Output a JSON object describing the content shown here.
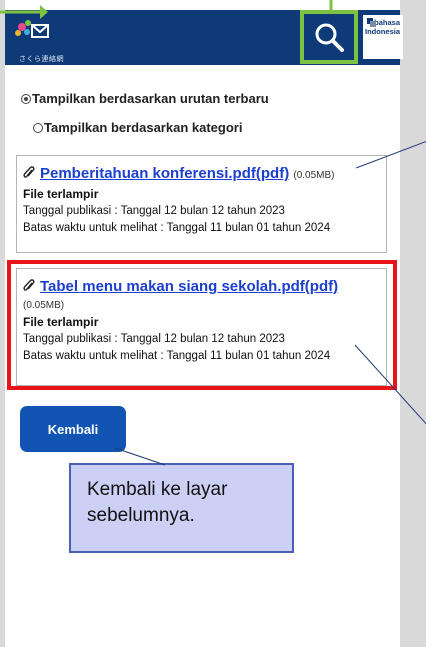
{
  "header": {
    "logo_text": "さくら連絡網",
    "lang_button_line1": "bahasa",
    "lang_button_line2": "Indonesia"
  },
  "sort_options": [
    {
      "label": "Tampilkan berdasarkan urutan terbaru",
      "checked": true
    },
    {
      "label": "Tampilkan berdasarkan kategori",
      "checked": false
    }
  ],
  "notices": [
    {
      "title": "Pemberitahuan konferensi.pdf(pdf)",
      "size": "(0.05MB)",
      "attachment_label": "File terlampir",
      "published": "Tanggal publikasi : Tanggal 12 bulan 12 tahun 2023",
      "deadline": "Batas waktu untuk melihat : Tanggal 11 bulan 01 tahun 2024"
    },
    {
      "title": "Tabel menu makan siang sekolah.pdf(pdf)",
      "size": "(0.05MB)",
      "attachment_label": "File terlampir",
      "published": "Tanggal publikasi : Tanggal 12 bulan 12 tahun 2023",
      "deadline": "Batas waktu untuk melihat : Tanggal 11 bulan 01 tahun 2024"
    }
  ],
  "back_button_label": "Kembali",
  "callout_text": "Kembali ke layar sebelumnya.",
  "colors": {
    "header_bg": "#0f3a78",
    "highlight_green": "#7dc242",
    "highlight_red": "#e8141a",
    "link_blue": "#1c3fcf",
    "button_blue": "#1254b3",
    "callout_bg": "#cdd0f5"
  },
  "icons": [
    "logo-icon",
    "search-icon",
    "language-icon",
    "paperclip-icon"
  ]
}
